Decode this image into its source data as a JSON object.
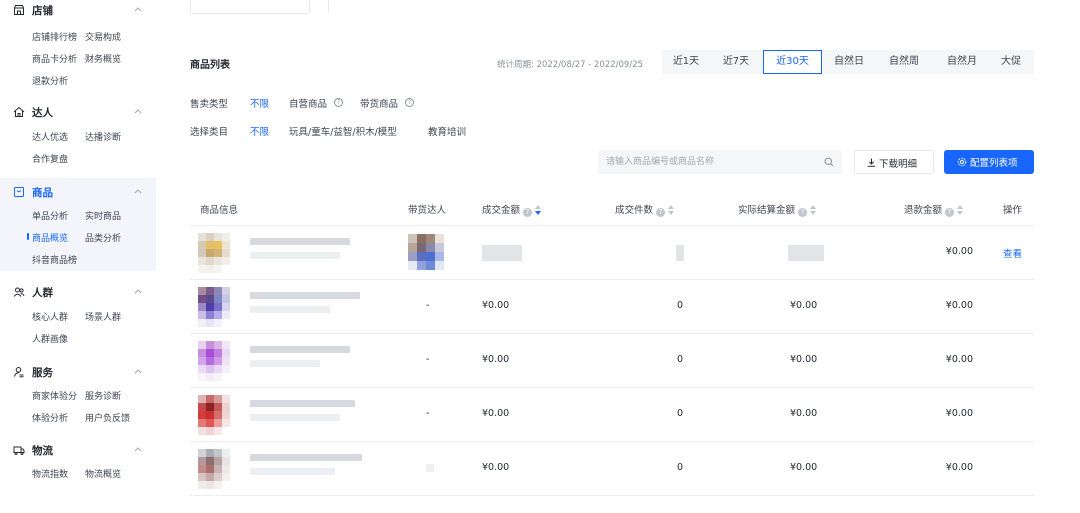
{
  "sidebar": {
    "groups": [
      {
        "title": "店铺",
        "icon": "store-icon",
        "active": false,
        "items": [
          [
            "店铺排行榜",
            "交易构成"
          ],
          [
            "商品卡分析",
            "财务概览"
          ],
          [
            "退款分析"
          ]
        ]
      },
      {
        "title": "达人",
        "icon": "influencer-icon",
        "active": false,
        "items": [
          [
            "达人优选",
            "达播诊断"
          ],
          [
            "合作复盘"
          ]
        ]
      },
      {
        "title": "商品",
        "icon": "product-icon",
        "active": true,
        "items": [
          [
            "单品分析",
            "实时商品"
          ],
          [
            "商品概览",
            "品类分析"
          ],
          [
            "抖音商品榜"
          ]
        ]
      },
      {
        "title": "人群",
        "icon": "audience-icon",
        "active": false,
        "items": [
          [
            "核心人群",
            "场景人群"
          ],
          [
            "人群画像"
          ]
        ]
      },
      {
        "title": "服务",
        "icon": "service-icon",
        "active": false,
        "items": [
          [
            "商家体验分",
            "服务诊断"
          ],
          [
            "体验分析",
            "用户负反馈"
          ]
        ]
      },
      {
        "title": "物流",
        "icon": "logistics-icon",
        "active": false,
        "items": [
          [
            "物流指数",
            "物流概览"
          ]
        ]
      }
    ],
    "active_item": "商品概览"
  },
  "header": {
    "title": "商品列表",
    "period_label": "统计周期: 2022/08/27 - 2022/09/25",
    "range_tabs": [
      "近1天",
      "近7天",
      "近30天",
      "自然日",
      "自然周",
      "自然月",
      "大促"
    ],
    "active_range": "近30天"
  },
  "filters": {
    "sale_type": {
      "label": "售卖类型",
      "options": [
        "不限",
        "自营商品",
        "带货商品"
      ],
      "active": "不限"
    },
    "category": {
      "label": "选择类目",
      "options": [
        "不限",
        "玩具/童车/益智/积木/模型",
        "教育培训"
      ],
      "active": "不限"
    }
  },
  "toolbar": {
    "search_placeholder": "请输入商品编号或商品名称",
    "download_label": "下载明细",
    "config_label": "配置列表项"
  },
  "table": {
    "columns": {
      "product": "商品信息",
      "influencer": "带货达人",
      "gmv": "成交金额",
      "orders": "成交件数",
      "settled": "实际结算金额",
      "refund": "退款金额",
      "action": "操作"
    },
    "rows": [
      {
        "influencer": "",
        "gmv": "",
        "orders": "",
        "settled": "",
        "refund": "¥0.00",
        "action": "查看"
      },
      {
        "influencer": "-",
        "gmv": "¥0.00",
        "orders": "0",
        "settled": "¥0.00",
        "refund": "¥0.00",
        "action": ""
      },
      {
        "influencer": "-",
        "gmv": "¥0.00",
        "orders": "0",
        "settled": "¥0.00",
        "refund": "¥0.00",
        "action": ""
      },
      {
        "influencer": "-",
        "gmv": "¥0.00",
        "orders": "0",
        "settled": "¥0.00",
        "refund": "¥0.00",
        "action": ""
      },
      {
        "influencer": "",
        "gmv": "¥0.00",
        "orders": "0",
        "settled": "¥0.00",
        "refund": "¥0.00",
        "action": ""
      }
    ]
  },
  "colors": {
    "accent": "#1966ff",
    "text": "#252931",
    "muted": "#8a8f99",
    "active_bg": "#f3f5fa"
  }
}
